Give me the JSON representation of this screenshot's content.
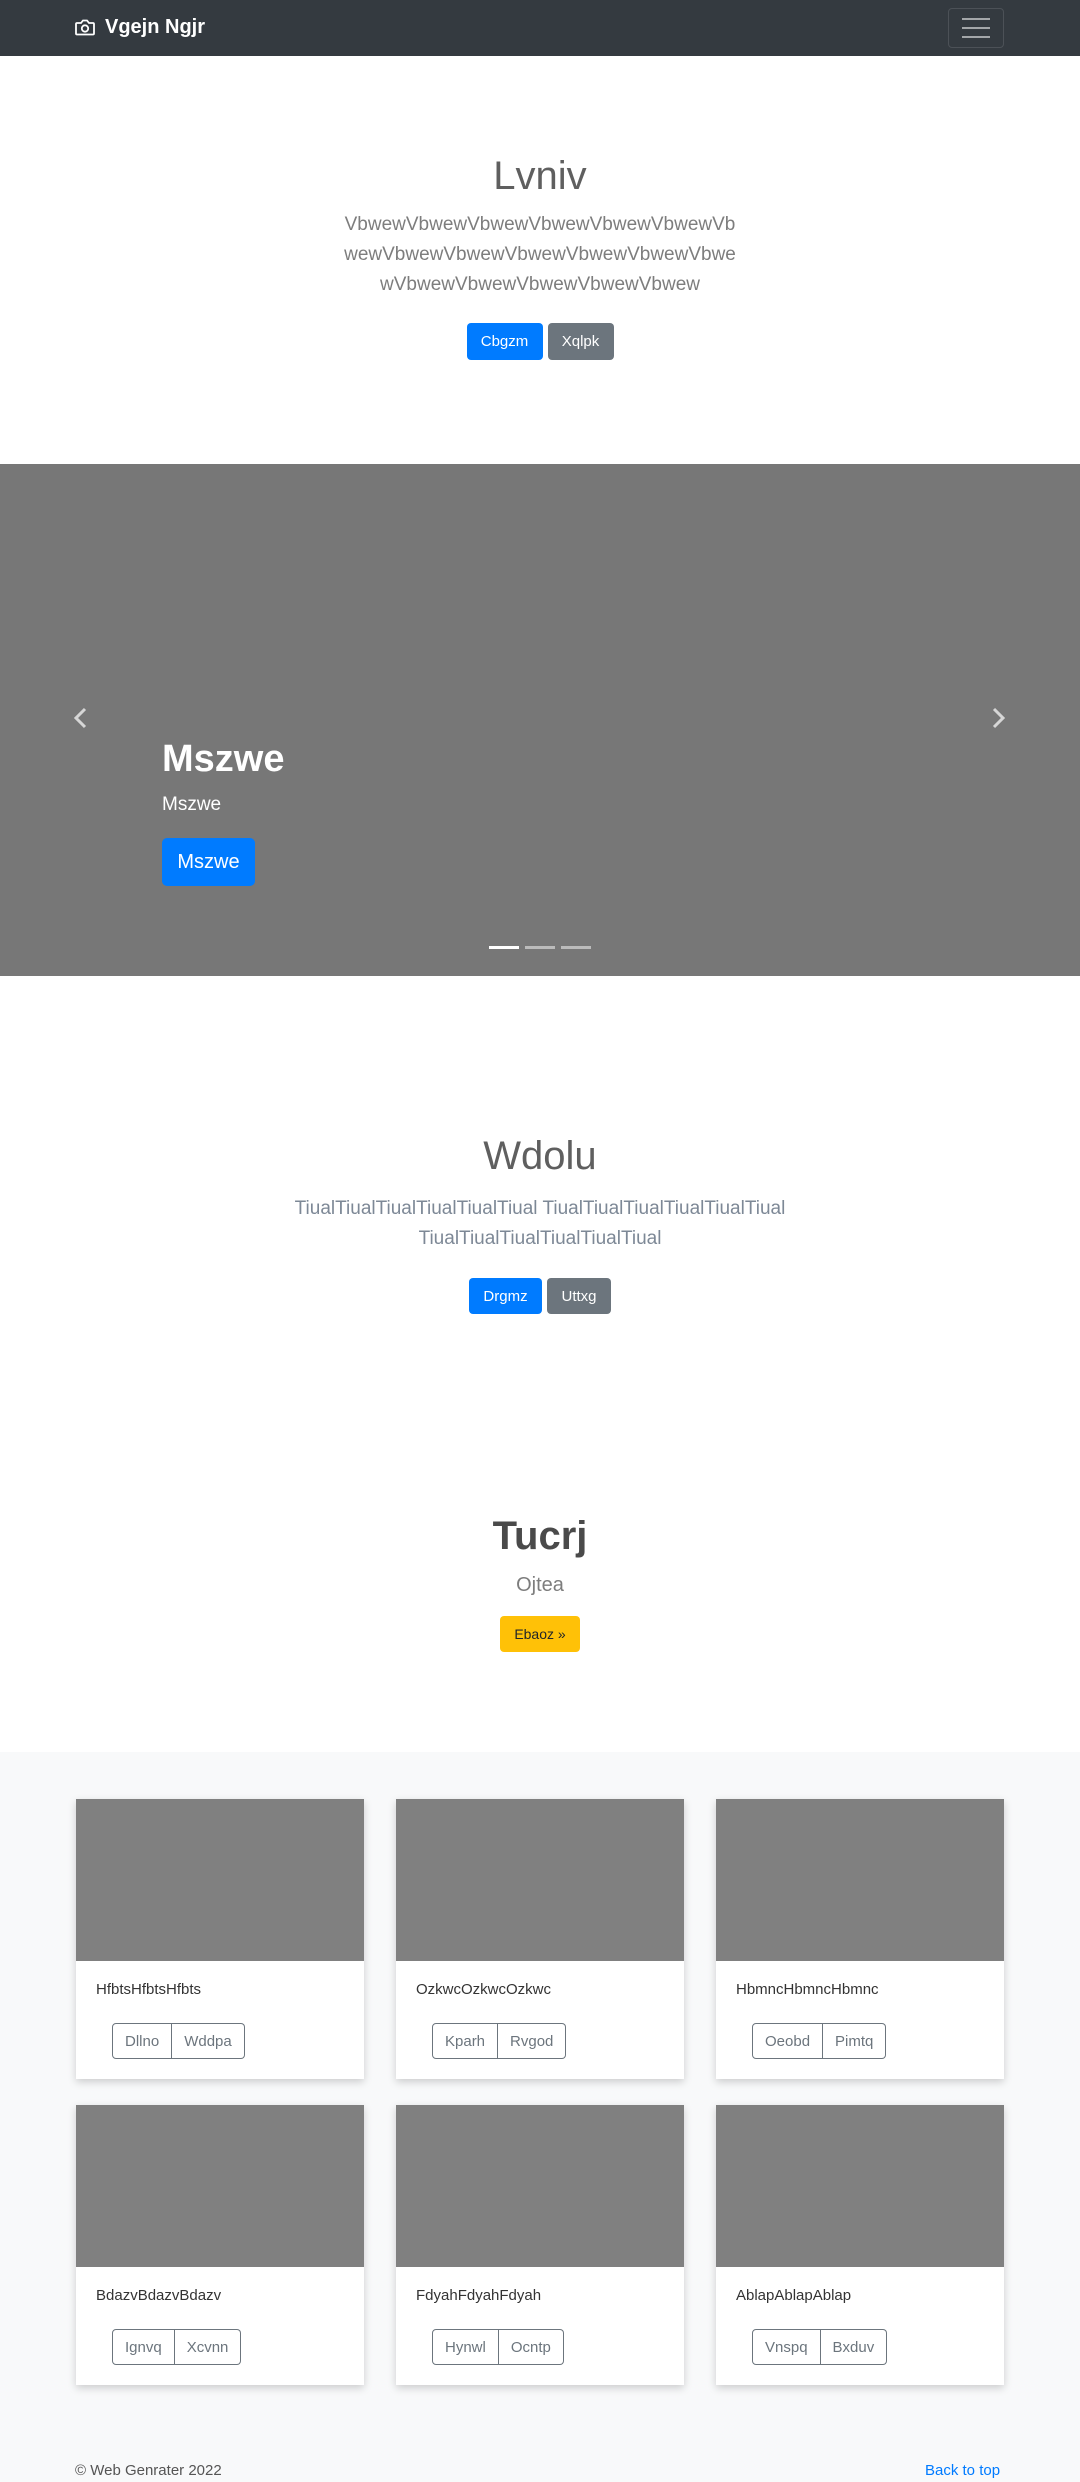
{
  "navbar": {
    "brand": "Vgejn Ngjr",
    "brand_icon": "camera-icon",
    "toggler_icon": "hamburger-icon"
  },
  "jumbo1": {
    "title": "Lvniv",
    "lead": "VbwewVbwewVbwewVbwewVbwewVbwewVbwewVbwewVbwewVbwewVbwewVbwewVbwewVbwewVbwewVbwewVbwewVbwew",
    "primary_label": "Cbgzm",
    "secondary_label": "Xqlpk"
  },
  "carousel": {
    "heading": "Mszwe",
    "text": "Mszwe",
    "button_label": "Mszwe",
    "slides": 3,
    "active_slide": 1
  },
  "jumbo2": {
    "title": "Wdolu",
    "lead": "TiualTiualTiualTiualTiualTiual TiualTiualTiualTiualTiualTiual TiualTiualTiualTiualTiualTiual",
    "primary_label": "Drgmz",
    "secondary_label": "Uttxg"
  },
  "section3": {
    "title": "Tucrj",
    "subtitle": "Ojtea",
    "button_label": "Ebaoz »"
  },
  "cards": [
    {
      "text": "HfbtsHfbtsHfbts",
      "btn1": "Dllno",
      "btn2": "Wddpa"
    },
    {
      "text": "OzkwcOzkwcOzkwc",
      "btn1": "Kparh",
      "btn2": "Rvgod"
    },
    {
      "text": "HbmncHbmncHbmnc",
      "btn1": "Oeobd",
      "btn2": "Pimtq"
    },
    {
      "text": "BdazvBdazvBdazv",
      "btn1": "Ignvq",
      "btn2": "Xcvnn"
    },
    {
      "text": "FdyahFdyahFdyah",
      "btn1": "Hynwl",
      "btn2": "Ocntp"
    },
    {
      "text": "AblapAblapAblap",
      "btn1": "Vnspq",
      "btn2": "Bxduv"
    }
  ],
  "footer": {
    "copyright": "© Web Genrater 2022",
    "back_to_top": "Back to top"
  },
  "colors": {
    "primary": "#007bff",
    "secondary": "#6c757d",
    "warning": "#ffc107",
    "navbar": "#343a40",
    "carousel_bg": "#777777"
  }
}
